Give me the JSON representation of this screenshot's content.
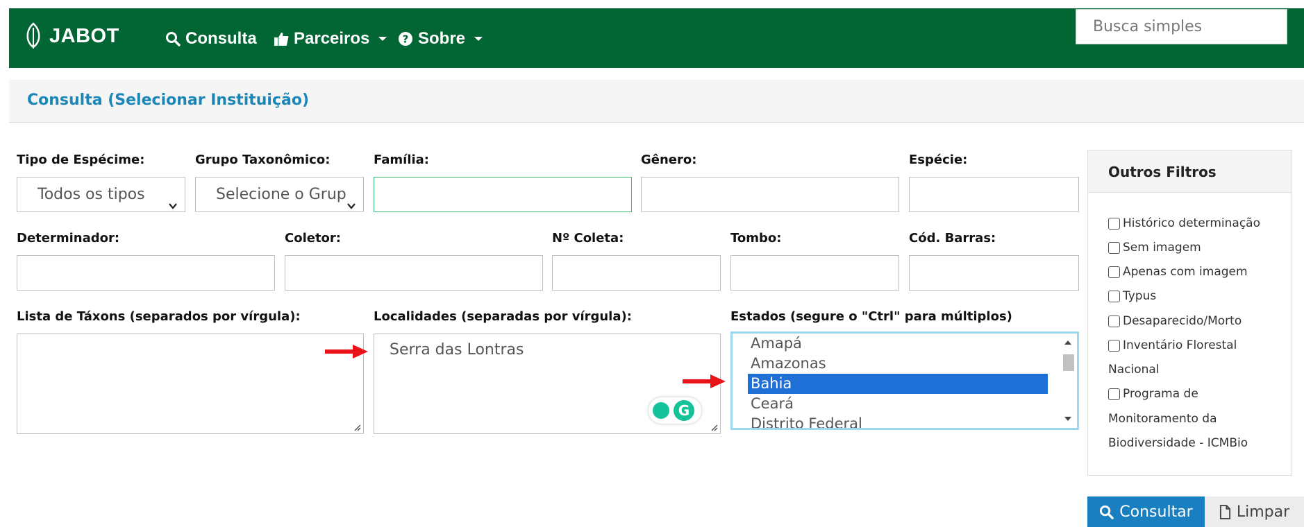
{
  "navbar": {
    "brand": "JABOT",
    "items": [
      {
        "label": "Consulta",
        "icon": "search-icon"
      },
      {
        "label": "Parceiros",
        "icon": "thumbs-up-icon"
      },
      {
        "label": "Sobre",
        "icon": "question-circle-icon"
      }
    ],
    "search_placeholder": "Busca simples",
    "bg_color": "#026634"
  },
  "panel": {
    "title": "Consulta (Selecionar Instituição)"
  },
  "form": {
    "tipo_label": "Tipo de Espécime:",
    "tipo_value": "Todos os tipos",
    "grupo_label": "Grupo Taxonômico:",
    "grupo_value": "Selecione o Grup",
    "familia_label": "Família:",
    "familia_value": "",
    "genero_label": "Gênero:",
    "genero_value": "",
    "especie_label": "Espécie:",
    "especie_value": "",
    "determinador_label": "Determinador:",
    "coletor_label": "Coletor:",
    "ncoleta_label": "Nº Coleta:",
    "tombo_label": "Tombo:",
    "codbarras_label": "Cód. Barras:",
    "taxons_label": "Lista de Táxons (separados por vírgula):",
    "taxons_value": "",
    "localidades_label": "Localidades (separadas por vírgula):",
    "localidades_value": "Serra das Lontras",
    "estados_label": "Estados (segure o \"Ctrl\" para múltiplos)",
    "estados_options": [
      "Amapá",
      "Amazonas",
      "Bahia",
      "Ceará",
      "Distrito Federal"
    ],
    "estados_selected": "Bahia"
  },
  "side": {
    "title": "Outros Filtros",
    "line1": "Histórico determinação",
    "line2": "Sem imagem",
    "line3": "Apenas com imagem",
    "line4": "Typus",
    "line5": "Desaparecido/Morto",
    "line6": "Inventário Florestal",
    "line7": "Nacional",
    "line8": "Programa de",
    "line9": "Monitoramento da",
    "line10": "Biodiversidade - ICMBio"
  },
  "buttons": {
    "consultar": "Consultar",
    "limpar": "Limpar"
  },
  "colors": {
    "accent_blue": "#1a87b8",
    "primary_button": "#1a7fc0",
    "selected_option": "#1e6fd6",
    "annotation_arrow": "#e8141a"
  }
}
